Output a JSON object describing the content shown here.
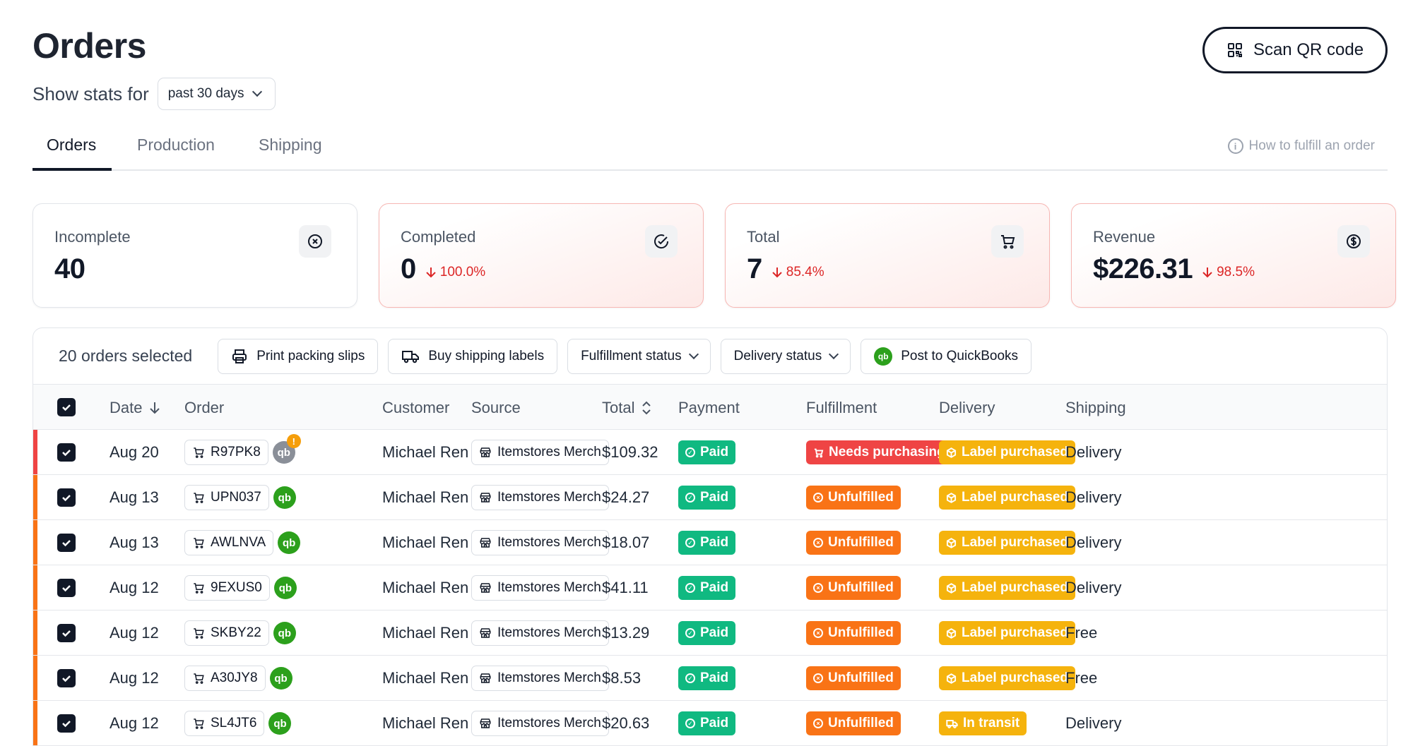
{
  "header": {
    "title": "Orders",
    "stats_label": "Show stats for",
    "period": "past 30 days",
    "scan_button": "Scan QR code"
  },
  "tabs": [
    {
      "label": "Orders",
      "active": true
    },
    {
      "label": "Production",
      "active": false
    },
    {
      "label": "Shipping",
      "active": false
    }
  ],
  "help_link": "How to fulfill an order",
  "stats": {
    "incomplete": {
      "label": "Incomplete",
      "value": "40",
      "icon": "x-circle-icon"
    },
    "completed": {
      "label": "Completed",
      "value": "0",
      "delta": "100.0%",
      "icon": "check-circle-icon"
    },
    "total": {
      "label": "Total",
      "value": "7",
      "delta": "85.4%",
      "icon": "cart-icon"
    },
    "revenue": {
      "label": "Revenue",
      "value": "$226.31",
      "delta": "98.5%",
      "icon": "dollar-circle-icon"
    }
  },
  "toolbar": {
    "selected": "20 orders selected",
    "print": "Print packing slips",
    "buy": "Buy shipping labels",
    "fulfillment_filter": "Fulfillment status",
    "delivery_filter": "Delivery status",
    "quickbooks": "Post to QuickBooks"
  },
  "columns": {
    "date": "Date",
    "order": "Order",
    "customer": "Customer",
    "source": "Source",
    "total": "Total",
    "payment": "Payment",
    "fulfillment": "Fulfillment",
    "delivery": "Delivery",
    "shipping": "Shipping"
  },
  "colors": {
    "paid": "#10b981",
    "needs_purchasing": "#ef4444",
    "unfulfilled": "#f97316",
    "label_purchased": "#f5b30d",
    "quickbooks": "#2ca01c"
  },
  "rows": [
    {
      "date": "Aug 20",
      "order": "R97PK8",
      "customer": "Michael Ren",
      "source": "Itemstores Merch",
      "total": "$109.32",
      "payment": "Paid",
      "fulfillment": "Needs purchasing",
      "delivery": "Label purchased",
      "shipping": "Delivery"
    },
    {
      "date": "Aug 13",
      "order": "UPN037",
      "customer": "Michael Ren",
      "source": "Itemstores Merch",
      "total": "$24.27",
      "payment": "Paid",
      "fulfillment": "Unfulfilled",
      "delivery": "Label purchased",
      "shipping": "Delivery"
    },
    {
      "date": "Aug 13",
      "order": "AWLNVA",
      "customer": "Michael Ren",
      "source": "Itemstores Merch",
      "total": "$18.07",
      "payment": "Paid",
      "fulfillment": "Unfulfilled",
      "delivery": "Label purchased",
      "shipping": "Delivery"
    },
    {
      "date": "Aug 12",
      "order": "9EXUS0",
      "customer": "Michael Ren",
      "source": "Itemstores Merch",
      "total": "$41.11",
      "payment": "Paid",
      "fulfillment": "Unfulfilled",
      "delivery": "Label purchased",
      "shipping": "Delivery"
    },
    {
      "date": "Aug 12",
      "order": "SKBY22",
      "customer": "Michael Ren",
      "source": "Itemstores Merch",
      "total": "$13.29",
      "payment": "Paid",
      "fulfillment": "Unfulfilled",
      "delivery": "Label purchased",
      "shipping": "Free"
    },
    {
      "date": "Aug 12",
      "order": "A30JY8",
      "customer": "Michael Ren",
      "source": "Itemstores Merch",
      "total": "$8.53",
      "payment": "Paid",
      "fulfillment": "Unfulfilled",
      "delivery": "Label purchased",
      "shipping": "Free"
    },
    {
      "date": "Aug 12",
      "order": "SL4JT6",
      "customer": "Michael Ren",
      "source": "Itemstores Merch",
      "total": "$20.63",
      "payment": "Paid",
      "fulfillment": "Unfulfilled",
      "delivery": "In transit",
      "shipping": "Delivery"
    }
  ]
}
